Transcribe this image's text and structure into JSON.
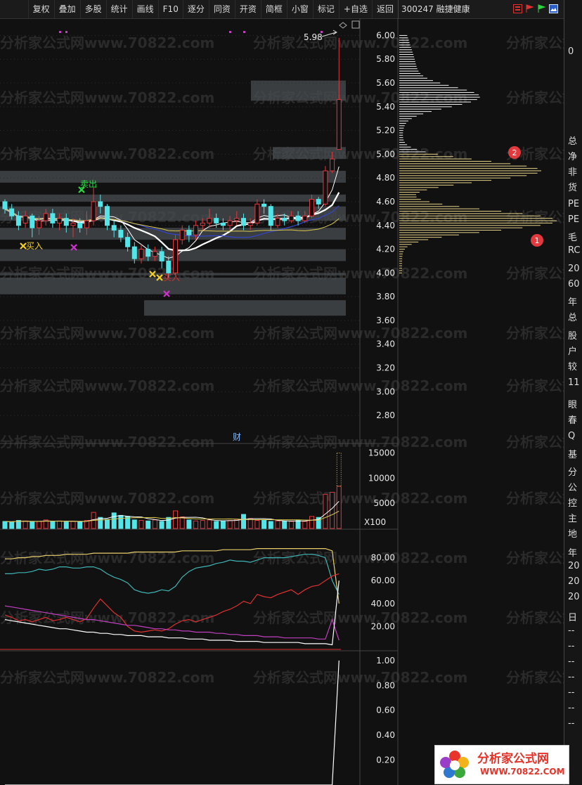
{
  "toolbar": {
    "buttons": [
      "复权",
      "叠加",
      "多股",
      "统计",
      "画线",
      "F10",
      "逐分",
      "同资",
      "开资",
      "简框",
      "小窗",
      "标记",
      "+自选",
      "返回"
    ]
  },
  "stock": {
    "code": "300247",
    "name": "融捷健康",
    "label": "300247 融捷健康"
  },
  "icons": [
    "grid-icon",
    "red-flag-icon",
    "green-flag-icon",
    "image-icon"
  ],
  "price_panel": {
    "ticks": [
      "6.00",
      "5.80",
      "5.60",
      "5.40",
      "5.20",
      "5.00",
      "4.80",
      "4.60",
      "4.40",
      "4.20",
      "4.00",
      "3.80",
      "3.60",
      "3.40",
      "3.20",
      "3.00",
      "2.80"
    ],
    "high_label": "5.98",
    "sell_label": "卖出",
    "buy_label_left": "买入",
    "buy_label_right": "买入",
    "finance_marker": "财",
    "badge_1": "1",
    "badge_2": "2"
  },
  "volume_panel": {
    "ticks": [
      "15000",
      "10000",
      "5000"
    ],
    "unit": "X100"
  },
  "indicator_panel": {
    "ticks": [
      "80.00",
      "60.00",
      "40.00",
      "20.00"
    ]
  },
  "bottom_panel": {
    "ticks": [
      "1.00",
      "0.80",
      "0.60",
      "0.40",
      "0.20"
    ]
  },
  "right_panel": {
    "items": [
      "0",
      "总",
      "净",
      "非",
      "货",
      "PE",
      "PE",
      "毛",
      "RC",
      "20",
      "60",
      "年",
      "总",
      "股",
      "户",
      "较",
      "11",
      "眼",
      "春",
      "Q",
      "基",
      "分",
      "公",
      "控",
      "主",
      "地",
      "年",
      "20",
      "20",
      "20",
      "日",
      "--",
      "--",
      "--",
      "--",
      "--",
      "--",
      "--"
    ]
  },
  "watermark": {
    "text": "分析家公式网www.70822.com"
  },
  "logo": {
    "name": "分析家公式网",
    "url": "WWW.70822.COM"
  },
  "colors": {
    "up": "#e0393e",
    "down": "#54e5e8",
    "ma5": "#ffffff",
    "ma10": "#ffffff",
    "ma20": "#3344cc",
    "ma60": "#d9c74c",
    "chip": "#e8d48a",
    "zone": "#4a4d52",
    "ind_yellow": "#e8d070",
    "ind_cyan": "#3fb4b4",
    "ind_red": "#e03030",
    "ind_magenta": "#c040c0"
  },
  "chart_data": [
    {
      "type": "candlestick",
      "title": "",
      "y_ticks": [
        6.0,
        5.8,
        5.6,
        5.4,
        5.2,
        5.0,
        4.8,
        4.6,
        4.4,
        4.2,
        4.0,
        3.8,
        3.6,
        3.4,
        3.2,
        3.0,
        2.8
      ],
      "ylim": [
        2.7,
        6.05
      ],
      "candles": [
        [
          4.6,
          4.54,
          4.62,
          4.5
        ],
        [
          4.54,
          4.48,
          4.58,
          4.45
        ],
        [
          4.48,
          4.4,
          4.52,
          4.36
        ],
        [
          4.42,
          4.48,
          4.52,
          4.38
        ],
        [
          4.48,
          4.38,
          4.5,
          4.3
        ],
        [
          4.38,
          4.44,
          4.48,
          4.32
        ],
        [
          4.44,
          4.5,
          4.54,
          4.4
        ],
        [
          4.5,
          4.42,
          4.54,
          4.38
        ],
        [
          4.42,
          4.46,
          4.5,
          4.36
        ],
        [
          4.46,
          4.4,
          4.5,
          4.34
        ],
        [
          4.4,
          4.42,
          4.46,
          4.3
        ],
        [
          4.42,
          4.38,
          4.46,
          4.34
        ],
        [
          4.38,
          4.44,
          4.52,
          4.32
        ],
        [
          4.44,
          4.6,
          4.72,
          4.4
        ],
        [
          4.6,
          4.56,
          4.66,
          4.5
        ],
        [
          4.56,
          4.4,
          4.58,
          4.36
        ],
        [
          4.4,
          4.36,
          4.44,
          4.3
        ],
        [
          4.36,
          4.3,
          4.4,
          4.26
        ],
        [
          4.3,
          4.22,
          4.34,
          4.18
        ],
        [
          4.22,
          4.12,
          4.26,
          4.08
        ],
        [
          4.12,
          4.2,
          4.24,
          4.08
        ],
        [
          4.2,
          4.14,
          4.24,
          4.1
        ],
        [
          4.14,
          4.18,
          4.22,
          4.1
        ],
        [
          4.18,
          4.1,
          4.22,
          4.04
        ],
        [
          4.1,
          4.0,
          4.14,
          3.96
        ],
        [
          4.0,
          4.28,
          4.32,
          3.98
        ],
        [
          4.28,
          4.36,
          4.4,
          4.24
        ],
        [
          4.36,
          4.32,
          4.4,
          4.26
        ],
        [
          4.32,
          4.4,
          4.44,
          4.28
        ],
        [
          4.4,
          4.42,
          4.46,
          4.36
        ],
        [
          4.42,
          4.46,
          4.54,
          4.38
        ],
        [
          4.46,
          4.42,
          4.5,
          4.38
        ],
        [
          4.42,
          4.4,
          4.46,
          4.36
        ],
        [
          4.4,
          4.44,
          4.48,
          4.36
        ],
        [
          4.44,
          4.46,
          4.52,
          4.4
        ],
        [
          4.46,
          4.4,
          4.5,
          4.36
        ],
        [
          4.4,
          4.42,
          4.46,
          4.36
        ],
        [
          4.42,
          4.58,
          4.62,
          4.4
        ],
        [
          4.58,
          4.56,
          4.62,
          4.5
        ],
        [
          4.56,
          4.4,
          4.58,
          4.36
        ],
        [
          4.4,
          4.46,
          4.5,
          4.38
        ],
        [
          4.46,
          4.44,
          4.5,
          4.4
        ],
        [
          4.44,
          4.48,
          4.52,
          4.42
        ],
        [
          4.48,
          4.44,
          4.52,
          4.4
        ],
        [
          4.44,
          4.48,
          4.52,
          4.42
        ],
        [
          4.48,
          4.62,
          4.66,
          4.46
        ],
        [
          4.62,
          4.58,
          4.64,
          4.54
        ],
        [
          4.58,
          4.86,
          4.9,
          4.56
        ],
        [
          4.86,
          4.96,
          5.02,
          4.84
        ],
        [
          5.04,
          5.46,
          5.98,
          5.04
        ]
      ],
      "zones": [
        [
          5.45,
          5.62
        ],
        [
          4.96,
          5.06
        ],
        [
          4.76,
          4.86
        ],
        [
          4.6,
          4.66
        ],
        [
          4.44,
          4.56
        ],
        [
          4.28,
          4.38
        ],
        [
          4.1,
          4.2
        ],
        [
          3.98,
          4.0
        ],
        [
          3.82,
          3.96
        ],
        [
          3.64,
          3.77
        ]
      ],
      "chip_peaks": [
        [
          4.44,
          1.0
        ],
        [
          4.86,
          0.9
        ],
        [
          5.48,
          0.45
        ]
      ]
    },
    {
      "type": "bar",
      "title": "volume",
      "y_ticks": [
        15000,
        10000,
        5000
      ],
      "ylim": [
        0,
        15500
      ],
      "values": [
        1400,
        1300,
        1600,
        1500,
        1300,
        1400,
        1700,
        1400,
        1500,
        1300,
        1400,
        1300,
        1600,
        3200,
        2200,
        1800,
        3100,
        2600,
        2400,
        1700,
        1600,
        1500,
        1700,
        1400,
        2200,
        3500,
        2300,
        1700,
        1500,
        1600,
        1700,
        1400,
        1500,
        1600,
        1800,
        2800,
        2000,
        1600,
        1600,
        1400,
        1500,
        1500,
        1400,
        1600,
        1400,
        2400,
        2200,
        6800,
        7200,
        8400
      ]
    },
    {
      "type": "line",
      "title": "indicator",
      "y_ticks": [
        80,
        60,
        40,
        20
      ],
      "ylim": [
        0,
        100
      ],
      "series": [
        {
          "key": "yellow",
          "values": [
            79,
            79,
            80,
            80,
            81,
            81,
            82,
            82,
            82,
            83,
            83,
            83,
            83,
            84,
            84,
            84,
            84,
            84,
            84,
            85,
            85,
            85,
            85,
            85,
            85,
            85,
            86,
            86,
            86,
            86,
            86,
            86,
            87,
            87,
            87,
            87,
            87,
            88,
            88,
            88,
            88,
            88,
            88,
            88,
            88,
            88,
            88,
            88,
            86,
            40
          ]
        },
        {
          "key": "cyan",
          "values": [
            66,
            66,
            67,
            67,
            68,
            70,
            69,
            70,
            72,
            72,
            71,
            71,
            72,
            72,
            70,
            66,
            63,
            61,
            58,
            52,
            50,
            49,
            50,
            52,
            51,
            55,
            63,
            68,
            71,
            72,
            73,
            75,
            76,
            78,
            77,
            77,
            76,
            78,
            80,
            80,
            80,
            80,
            81,
            82,
            83,
            83,
            82,
            80,
            60,
            48
          ]
        },
        {
          "key": "red",
          "values": [
            30,
            28,
            25,
            26,
            24,
            26,
            28,
            25,
            26,
            28,
            26,
            24,
            27,
            36,
            44,
            38,
            32,
            28,
            20,
            16,
            15,
            16,
            17,
            16,
            18,
            22,
            25,
            26,
            24,
            26,
            28,
            30,
            33,
            35,
            38,
            42,
            40,
            48,
            46,
            45,
            48,
            50,
            52,
            48,
            52,
            55,
            56,
            60,
            64,
            66
          ]
        },
        {
          "key": "magenta",
          "values": [
            38,
            37,
            36,
            35,
            34,
            33,
            32,
            31,
            30,
            29,
            28,
            27,
            26,
            26,
            25,
            24,
            23,
            22,
            21,
            21,
            20,
            19,
            18,
            18,
            17,
            17,
            16,
            16,
            15,
            15,
            15,
            14,
            14,
            13,
            13,
            12,
            12,
            12,
            11,
            11,
            11,
            10,
            10,
            10,
            10,
            10,
            9,
            9,
            26,
            8
          ]
        }
      ]
    },
    {
      "type": "line",
      "title": "signal",
      "y_ticks": [
        1.0,
        0.8,
        0.6,
        0.4,
        0.2
      ],
      "ylim": [
        0,
        1.05
      ],
      "values": [
        0,
        0,
        0,
        0,
        0,
        0,
        0,
        0,
        0,
        0,
        0,
        0,
        0,
        0,
        0,
        0,
        0,
        0,
        0,
        0,
        0,
        0,
        0,
        0,
        0,
        0,
        0,
        0,
        0,
        0,
        0,
        0,
        0,
        0,
        0,
        0,
        0,
        0,
        0,
        0,
        0,
        0,
        0,
        0,
        0,
        0,
        0,
        0,
        0,
        1.0
      ]
    }
  ]
}
